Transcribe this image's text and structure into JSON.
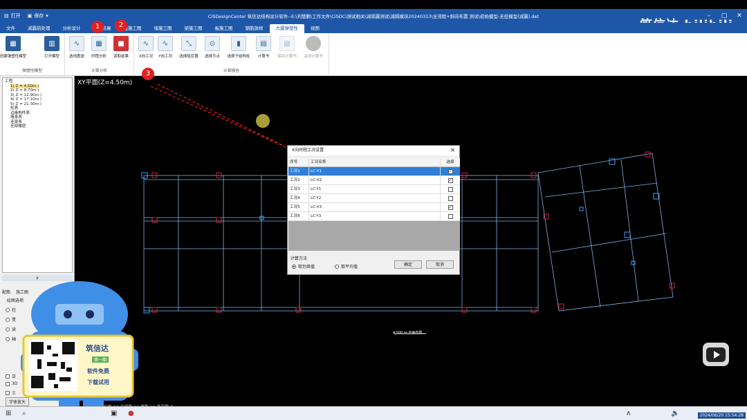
{
  "titlebar": {
    "open_label": "打开",
    "save_label": "保存",
    "title": "CiSDesignCenter 筑信达结构设计软件--E:\\刘楚鹏\\工作文件\\CiSDC\\测试相关\\减隔震测试\\减隔模块20240313\\全流程+斜向布置 测试\\初始模型-无控模型(减震).det",
    "brand": "筑信达 bilibili"
  },
  "menu": {
    "items": [
      "文件",
      "减震前处理",
      "分析设计",
      "计算结果",
      "柱施工图",
      "墙施工图",
      "梁施工图",
      "板施工图",
      "钢筋放样",
      "大震弹塑性",
      "视图"
    ],
    "active": "大震弹塑性"
  },
  "ribbon": {
    "group1": {
      "label": "弹塑性模型",
      "buttons": [
        "创建弹塑性模型",
        "打开模型"
      ]
    },
    "group2": {
      "label": "计算分析",
      "buttons": [
        "选地震波",
        "时程分析",
        "读取结果"
      ]
    },
    "group3": {
      "label": "计算报告",
      "buttons": [
        "X向工况",
        "Y向工况",
        "选择阻尼器",
        "选择节点",
        "选择子结构柱",
        "计算书",
        "保存计算书",
        "关闭计算书"
      ]
    }
  },
  "tree": {
    "root": "工程",
    "floors": [
      "1( Z = 4.50m )",
      "2( Z = 8.70m )",
      "3( Z = 12.90m )",
      "4( Z = 17.10m )",
      "5( Z = 21.30m )"
    ],
    "items": [
      "柱表",
      "边缘构件表",
      "墙身表",
      "连梁表",
      "全部楼层"
    ]
  },
  "leftpanel": {
    "collapse_glyph": "∨",
    "tabs": [
      "配筋",
      "施工图"
    ],
    "section_label": "绘图选项",
    "options": [
      "柱",
      "贯",
      "读",
      "轴"
    ],
    "checks": [
      "日",
      "3D",
      "三"
    ],
    "bottom_button": "字体放大"
  },
  "canvas": {
    "view_label": "XY平面(Z=4.50m)",
    "status": "柱数 24  支撑数 12  墙数 16  连梁数 0",
    "scale_label": "4.500 m 平面布置"
  },
  "dialog": {
    "title": "X向时程工况设置",
    "columns": [
      "序号",
      "工况名称",
      "选择"
    ],
    "rows": [
      {
        "id": "工况1",
        "name": "LC-X1",
        "checked": true
      },
      {
        "id": "工况2",
        "name": "LC-X2",
        "checked": true
      },
      {
        "id": "工况3",
        "name": "LC-Y1",
        "checked": false
      },
      {
        "id": "工况4",
        "name": "LC-Y2",
        "checked": false
      },
      {
        "id": "工况5",
        "name": "LC-X3",
        "checked": true
      },
      {
        "id": "工况6",
        "name": "LC-Y3",
        "checked": false
      }
    ],
    "method_label": "计算方法",
    "method_options": [
      "取包络值",
      "取平均值"
    ],
    "ok": "确定",
    "cancel": "取消"
  },
  "markers": [
    "1",
    "2",
    "3"
  ],
  "mascot": {
    "brand": "筑信达",
    "sub": "第一期",
    "line1": "软件免费",
    "line2": "下载试用"
  },
  "taskbar": {
    "time": "2024/06/20 15:54:28"
  },
  "colors": {
    "titlebar": "#1f57a8",
    "selected_row": "#2f7ed8",
    "marker": "#e02020"
  }
}
